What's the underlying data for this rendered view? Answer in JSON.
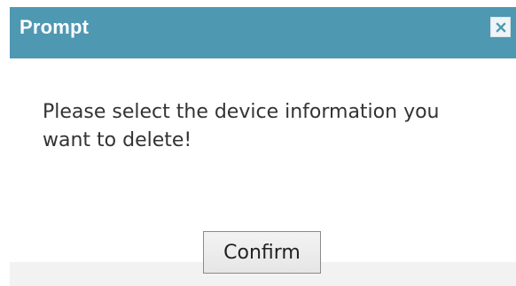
{
  "dialog": {
    "title": "Prompt",
    "message": "Please select the device information you want to delete!",
    "confirm_label": "Confirm",
    "close_icon": "close-icon"
  },
  "colors": {
    "title_bar": "#4e98b2",
    "title_text": "#ffffff",
    "message_text": "#333333",
    "footer_background": "#f2f2f2"
  }
}
